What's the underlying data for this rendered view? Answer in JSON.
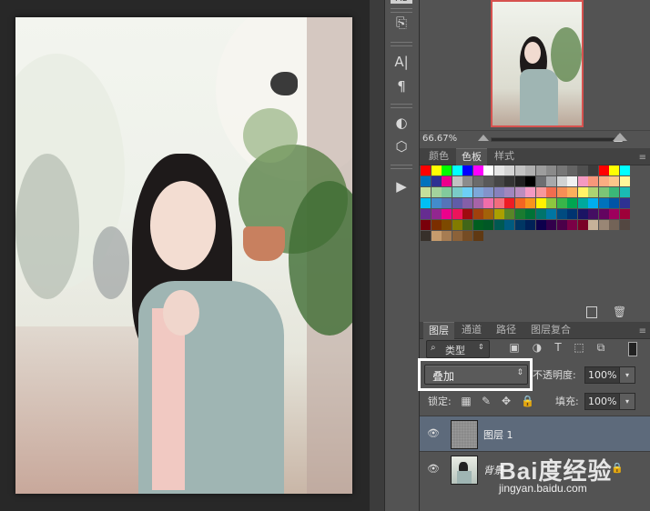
{
  "zoom": "66.67%",
  "swatch_panel": {
    "tabs": [
      {
        "label": "颜色",
        "active": false
      },
      {
        "label": "色板",
        "active": true
      },
      {
        "label": "样式",
        "active": false
      }
    ]
  },
  "layers_panel": {
    "tabs": [
      {
        "label": "图层",
        "active": true
      },
      {
        "label": "通道",
        "active": false
      },
      {
        "label": "路径",
        "active": false
      },
      {
        "label": "图层复合",
        "active": false
      }
    ],
    "filter_label": "类型",
    "blend_mode": "叠加",
    "opacity_label": "不透明度:",
    "opacity_value": "100%",
    "lock_label": "锁定:",
    "fill_label": "填充:",
    "fill_value": "100%",
    "layers": [
      {
        "name": "图层 1",
        "visible": true,
        "selected": true
      },
      {
        "name": "背景",
        "visible": true,
        "selected": false,
        "locked": true
      }
    ]
  },
  "toolbar": {
    "icons": [
      "history-icon",
      "character-icon",
      "paragraph-icon",
      "adjustments-icon",
      "3d-cube-icon",
      "play-actions-icon"
    ]
  },
  "watermark": {
    "brand": "Bai度经验",
    "url": "jingyan.baidu.com"
  }
}
